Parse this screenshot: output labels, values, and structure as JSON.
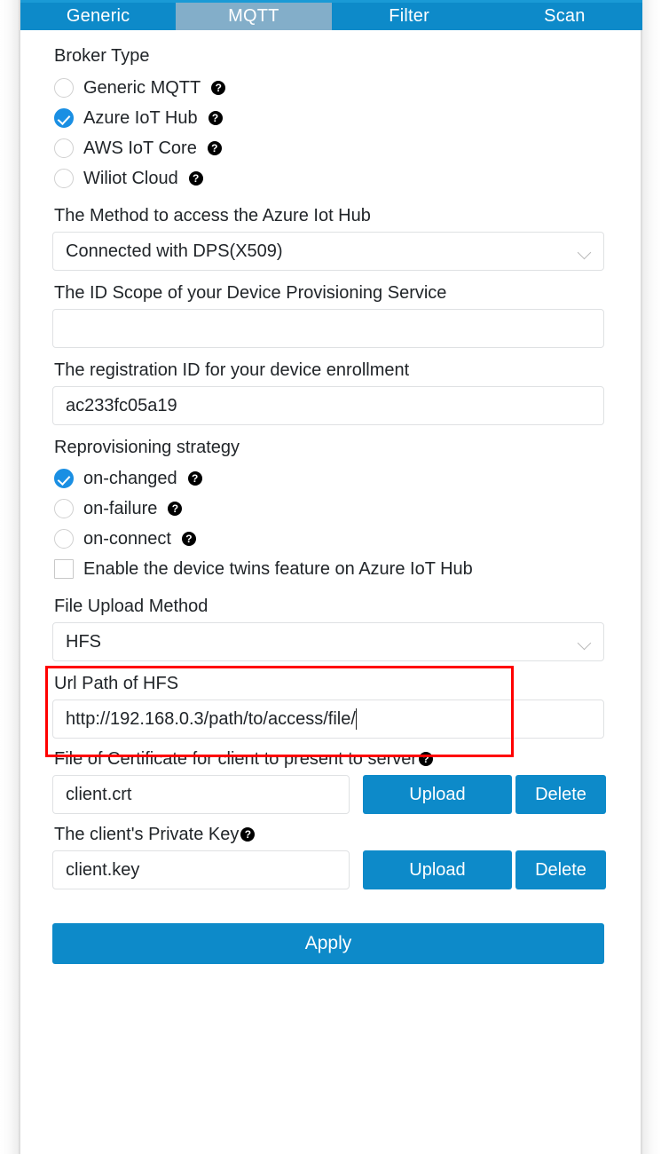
{
  "tabs": [
    {
      "label": "Generic",
      "active": false
    },
    {
      "label": "MQTT",
      "active": true
    },
    {
      "label": "Filter",
      "active": false
    },
    {
      "label": "Scan",
      "active": false
    }
  ],
  "broker": {
    "section_label": "Broker Type",
    "options": [
      {
        "label": "Generic MQTT",
        "selected": false,
        "help": "?"
      },
      {
        "label": "Azure IoT Hub",
        "selected": true,
        "help": "?"
      },
      {
        "label": "AWS IoT Core",
        "selected": false,
        "help": "?"
      },
      {
        "label": "Wiliot Cloud",
        "selected": false,
        "help": "?"
      }
    ]
  },
  "method": {
    "label": "The Method to access the Azure Iot Hub",
    "value": "Connected with DPS(X509)"
  },
  "id_scope": {
    "label": "The ID Scope of your Device Provisioning Service",
    "value": "",
    "placeholder": ""
  },
  "registration_id": {
    "label": "The registration ID for your device enrollment",
    "value": "ac233fc05a19",
    "placeholder": ""
  },
  "reprovisioning": {
    "section_label": "Reprovisioning strategy",
    "options": [
      {
        "label": "on-changed",
        "selected": true,
        "help": "?"
      },
      {
        "label": "on-failure",
        "selected": false,
        "help": "?"
      },
      {
        "label": "on-connect",
        "selected": false,
        "help": "?"
      }
    ],
    "device_twins": {
      "label": "Enable the device twins feature on Azure IoT Hub",
      "checked": false
    }
  },
  "file_upload": {
    "label": "File Upload Method",
    "value": "HFS"
  },
  "url_path": {
    "label": "Url Path of HFS",
    "value": "http://192.168.0.3/path/to/access/file/",
    "highlighted": true,
    "highlight_color": "#ff0000"
  },
  "client_cert": {
    "label": "File of Certificate for client to present to server",
    "help": "?",
    "value": "client.crt",
    "upload_label": "Upload",
    "delete_label": "Delete"
  },
  "private_key": {
    "label": "The client's Private Key",
    "help": "?",
    "value": "client.key",
    "upload_label": "Upload",
    "delete_label": "Delete"
  },
  "apply": {
    "label": "Apply"
  },
  "colors": {
    "accent_blue": "#0d8ac9",
    "active_tab": "#83aec9",
    "radio_checked": "#1a8fe3",
    "highlight": "#ff0000"
  }
}
